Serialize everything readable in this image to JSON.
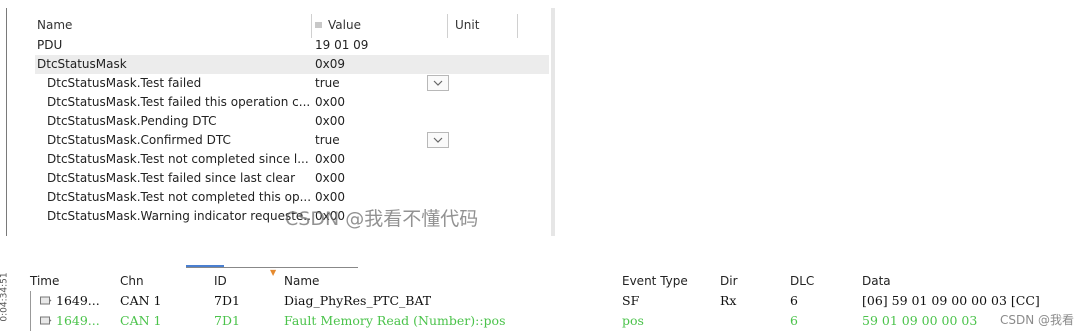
{
  "properties": {
    "columns": {
      "name": "Name",
      "value": "Value",
      "unit": "Unit"
    },
    "rows": [
      {
        "name": "PDU",
        "value": "19 01 09",
        "unit": "",
        "level": 0
      },
      {
        "name": "DtcStatusMask",
        "value": "0x09",
        "unit": "",
        "level": 0,
        "selected": true
      },
      {
        "name": "DtcStatusMask.Test failed",
        "value": "true",
        "unit": "",
        "level": 1,
        "dropdown": true
      },
      {
        "name": "DtcStatusMask.Test failed this operation c...",
        "value": "0x00",
        "unit": "",
        "level": 1
      },
      {
        "name": "DtcStatusMask.Pending DTC",
        "value": "0x00",
        "unit": "",
        "level": 1
      },
      {
        "name": "DtcStatusMask.Confirmed DTC",
        "value": "true",
        "unit": "",
        "level": 1,
        "dropdown": true
      },
      {
        "name": "DtcStatusMask.Test not completed since l...",
        "value": "0x00",
        "unit": "",
        "level": 1
      },
      {
        "name": "DtcStatusMask.Test failed since last clear",
        "value": "0x00",
        "unit": "",
        "level": 1
      },
      {
        "name": "DtcStatusMask.Test not completed this op...",
        "value": "0x00",
        "unit": "",
        "level": 1
      },
      {
        "name": "DtcStatusMask.Warning indicator requeste...",
        "value": "0x00",
        "unit": "",
        "level": 1
      }
    ],
    "watermark": "CSDN @我看不懂代码"
  },
  "trace": {
    "time_label": "0:04:34:51",
    "columns": {
      "time": "Time",
      "chn": "Chn",
      "id": "ID",
      "name": "Name",
      "event_type": "Event Type",
      "dir": "Dir",
      "dlc": "DLC",
      "data": "Data"
    },
    "rows": [
      {
        "time": "1649...",
        "chn": "CAN 1",
        "id": "7D1",
        "name": "Diag_PhyRes_PTC_BAT",
        "event_type": "SF",
        "dir": "Rx",
        "dlc": "6",
        "data": "[06] 59 01 09 00 00 03 [CC]",
        "color": "#111111"
      },
      {
        "time": "1649...",
        "chn": "CAN 1",
        "id": "7D1",
        "name": "Fault Memory Read (Number)::pos",
        "event_type": "pos",
        "dir": "",
        "dlc": "6",
        "data": "59 01 09 00 00 03",
        "color": "#4bc34b"
      }
    ],
    "watermark": "CSDN @我看"
  }
}
